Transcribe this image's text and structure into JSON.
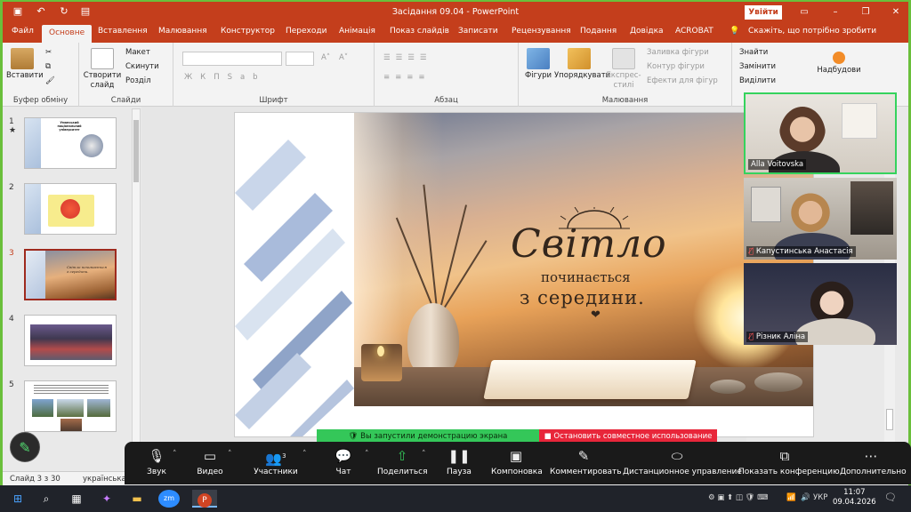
{
  "app": {
    "title": "Засідання 09.04  -  PowerPoint",
    "login_label": "Увійти",
    "tell_me": "Скажіть, що потрібно зробити",
    "tabs": [
      "Файл",
      "Основне",
      "Вставлення",
      "Малювання",
      "Конструктор",
      "Переходи",
      "Анімація",
      "Показ слайдів",
      "Записати",
      "Рецензування",
      "Подання",
      "Довідка",
      "ACROBAT"
    ],
    "active_tab": "Основне"
  },
  "ribbon": {
    "clipboard": {
      "label": "Буфер обміну",
      "paste": "Вставити"
    },
    "slides": {
      "label": "Слайди",
      "new_slide": "Створити слайд",
      "layout": "Макет",
      "reset": "Скинути",
      "section": "Розділ"
    },
    "font": {
      "label": "Шрифт"
    },
    "paragraph": {
      "label": "Абзац"
    },
    "drawing": {
      "label": "Малювання",
      "shapes": "Фігури",
      "arrange": "Упорядкувати",
      "quick_styles": "Експрес-стилі",
      "fill": "Заливка фігури",
      "outline": "Контур фігури",
      "effects": "Ефекти для фігур"
    },
    "editing": {
      "find": "Знайти",
      "replace": "Замінити",
      "select": "Виділити"
    },
    "addins": {
      "label": "Надбудови"
    }
  },
  "thumbnails": [
    {
      "num": "1",
      "caption": "Уманський національний університет"
    },
    {
      "num": "2",
      "caption": ""
    },
    {
      "num": "3",
      "caption": "Світло починається з середини."
    },
    {
      "num": "4",
      "caption": ""
    },
    {
      "num": "5",
      "caption": ""
    }
  ],
  "current_slide": "3",
  "slide": {
    "line1": "Світло",
    "line2": "починається",
    "line3": "з середини.",
    "heart": "❤"
  },
  "participants": [
    {
      "name": "Alla Voitovska",
      "muted": false
    },
    {
      "name": "Капустинська Анастасія",
      "muted": true
    },
    {
      "name": "Різник  Аліна",
      "muted": true
    }
  ],
  "status": {
    "slide_info": "Слайд 3 з 30",
    "language": "українська"
  },
  "share_banner": {
    "info": "Вы запустили демонстрацию экрана",
    "stop": "Остановить совместное использование"
  },
  "zoom_toolbar": [
    {
      "label": "Звук",
      "icon": "mic-icon",
      "glyph": "🎙"
    },
    {
      "label": "Видео",
      "icon": "video-icon",
      "glyph": "▭"
    },
    {
      "label": "Участники",
      "icon": "participants-icon",
      "glyph": "👥",
      "badge": "3"
    },
    {
      "label": "Чат",
      "icon": "chat-icon",
      "glyph": "💬"
    },
    {
      "label": "Поделиться",
      "icon": "share-icon",
      "glyph": "⇧"
    },
    {
      "label": "Пауза",
      "icon": "pause-icon",
      "glyph": "❚❚"
    },
    {
      "label": "Компоновка",
      "icon": "layout-icon",
      "glyph": "▣"
    },
    {
      "label": "Комментировать",
      "icon": "annotate-icon",
      "glyph": "✎"
    },
    {
      "label": "Дистанционное управление",
      "icon": "remote-control-icon",
      "glyph": "⬭"
    },
    {
      "label": "Показать конференцию",
      "icon": "show-meeting-icon",
      "glyph": "⧉"
    },
    {
      "label": "Дополнительно",
      "icon": "more-icon",
      "glyph": "⋯"
    }
  ],
  "taskbar": {
    "time": "11:07",
    "date": "09.04.2026",
    "lang": "УКР"
  },
  "colors": {
    "accent": "#c43e1c",
    "share_green": "#34c759",
    "stop_red": "#e8263a",
    "border_green": "#6abf3b"
  }
}
